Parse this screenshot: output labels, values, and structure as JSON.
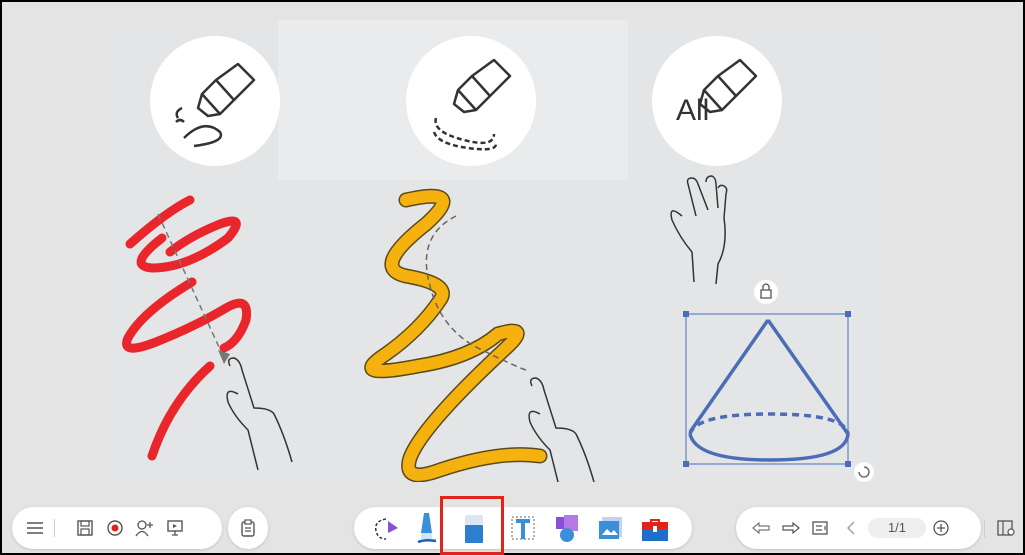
{
  "canvas": {
    "panels": [
      {
        "name": "eraser-stroke",
        "icon": "eraser-partial-stroke-icon"
      },
      {
        "name": "eraser-object",
        "icon": "eraser-whole-object-icon"
      },
      {
        "name": "eraser-all",
        "icon": "eraser-all-icon",
        "label": "All"
      }
    ],
    "stroke_colors": {
      "red": "#e8262b",
      "yellow": "#f5b20f",
      "cone": "#4a6db5"
    }
  },
  "toolbar": {
    "left": [
      "menu-icon",
      "save-icon",
      "record-icon",
      "add-user-icon",
      "present-icon"
    ],
    "clipboard": "clipboard-icon",
    "center": [
      "lasso-select-icon",
      "pen-icon",
      "eraser-icon",
      "text-icon",
      "shapes-icon",
      "image-icon",
      "toolbox-icon"
    ],
    "right": [
      "undo-icon",
      "redo-icon",
      "page-list-icon",
      "prev-page-icon",
      "next-page-icon",
      "add-page-icon",
      "page-panel-icon"
    ],
    "page_indicator": "1/1",
    "selected_tool": "eraser-icon",
    "highlight_color": "#e2231a"
  }
}
